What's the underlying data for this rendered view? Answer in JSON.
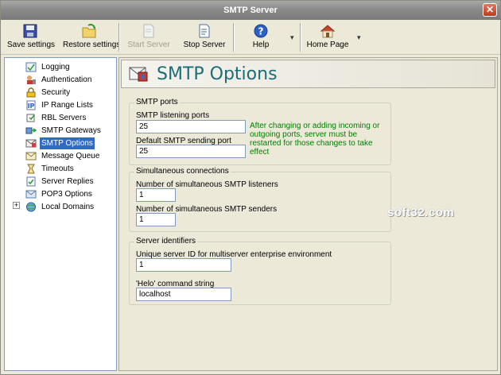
{
  "window": {
    "title": "SMTP Server"
  },
  "toolbar": {
    "save_label": "Save settings",
    "restore_label": "Restore settings",
    "start_label": "Start Server",
    "stop_label": "Stop Server",
    "help_label": "Help",
    "home_label": "Home Page"
  },
  "nav": {
    "items": [
      {
        "label": "Logging",
        "icon": "logging-icon"
      },
      {
        "label": "Authentication",
        "icon": "authentication-icon"
      },
      {
        "label": "Security",
        "icon": "lock-icon"
      },
      {
        "label": "IP Range Lists",
        "icon": "ip-range-icon"
      },
      {
        "label": "RBL Servers",
        "icon": "rbl-servers-icon"
      },
      {
        "label": "SMTP Gateways",
        "icon": "gateways-icon"
      },
      {
        "label": "SMTP Options",
        "icon": "smtp-options-icon"
      },
      {
        "label": "Message Queue",
        "icon": "message-queue-icon"
      },
      {
        "label": "Timeouts",
        "icon": "timeouts-icon"
      },
      {
        "label": "Server Replies",
        "icon": "server-replies-icon"
      },
      {
        "label": "POP3 Options",
        "icon": "pop3-options-icon"
      },
      {
        "label": "Local Domains",
        "icon": "local-domains-icon"
      }
    ],
    "selected": "SMTP Options"
  },
  "content": {
    "title": "SMTP Options",
    "smtp_ports": {
      "group_title": "SMTP ports",
      "listening_label": "SMTP listening ports",
      "listening_value": "25",
      "sending_label": "Default SMTP sending port",
      "sending_value": "25",
      "note": "After changing or adding incoming or outgoing ports, server must be restarted for those changes to take effect"
    },
    "connections": {
      "group_title": "Simultaneous connections",
      "listeners_label": "Number of simultaneous SMTP listeners",
      "listeners_value": "1",
      "senders_label": "Number of simultaneous SMTP senders",
      "senders_value": "1"
    },
    "identifiers": {
      "group_title": "Server identifiers",
      "server_id_label": "Unique server ID for multiserver enterprise environment",
      "server_id_value": "1",
      "helo_label": "'Helo' command string",
      "helo_value": "localhost"
    }
  },
  "watermark": "soft32.com",
  "colors": {
    "accent": "#316AC5",
    "title": "#1A6E78",
    "note": "#008000"
  }
}
